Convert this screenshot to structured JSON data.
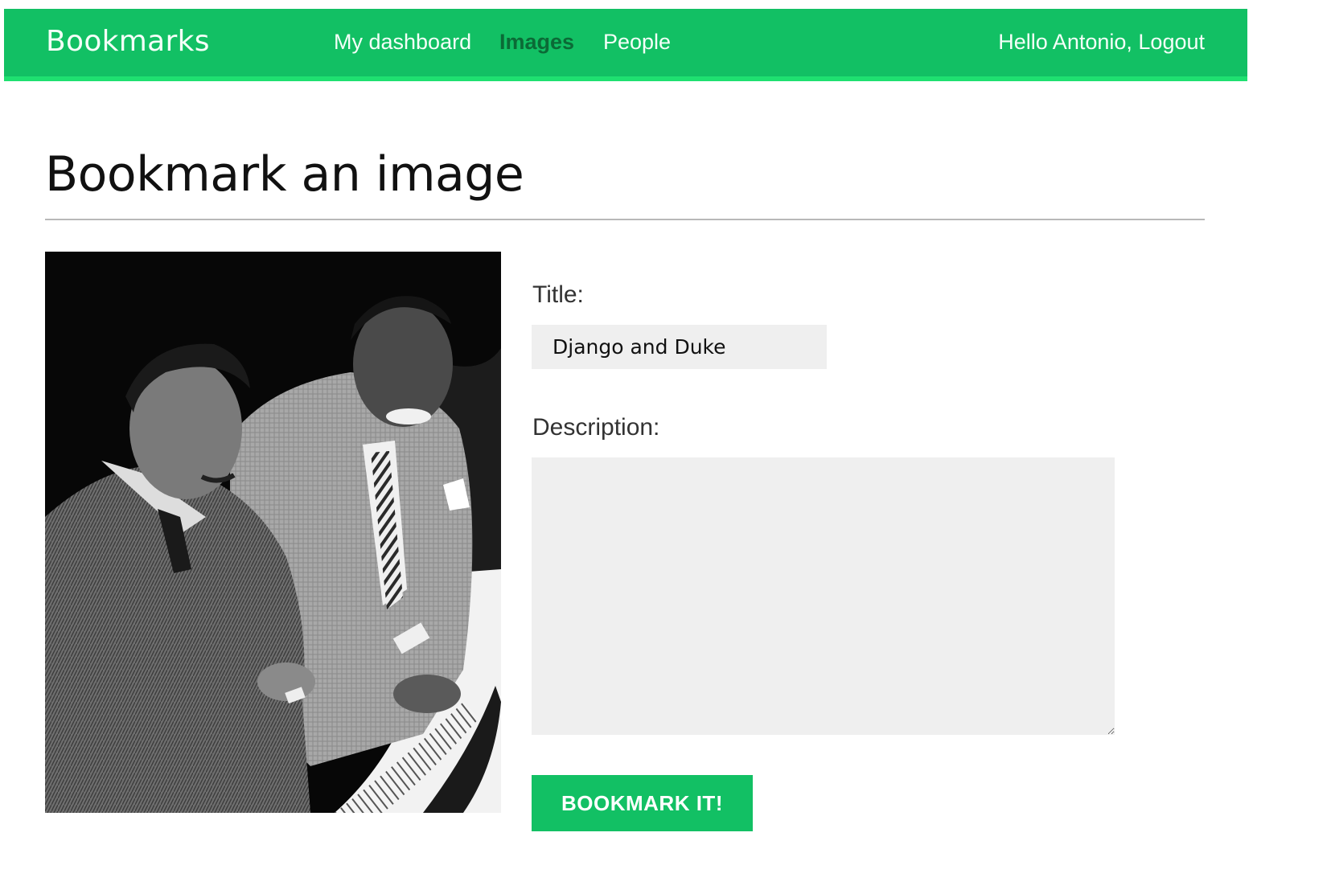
{
  "header": {
    "brand": "Bookmarks",
    "nav": [
      {
        "label": "My dashboard",
        "active": false
      },
      {
        "label": "Images",
        "active": true
      },
      {
        "label": "People",
        "active": false
      }
    ],
    "greeting": "Hello Antonio,",
    "logout_label": "Logout"
  },
  "page": {
    "title": "Bookmark an image"
  },
  "form": {
    "title_label": "Title:",
    "title_value": "Django and Duke",
    "description_label": "Description:",
    "description_value": "",
    "submit_label": "BOOKMARK IT!"
  },
  "colors": {
    "header_bg": "#12c064",
    "header_border": "#1ee070",
    "active_nav": "#0b6a36",
    "input_bg": "#efefef"
  }
}
